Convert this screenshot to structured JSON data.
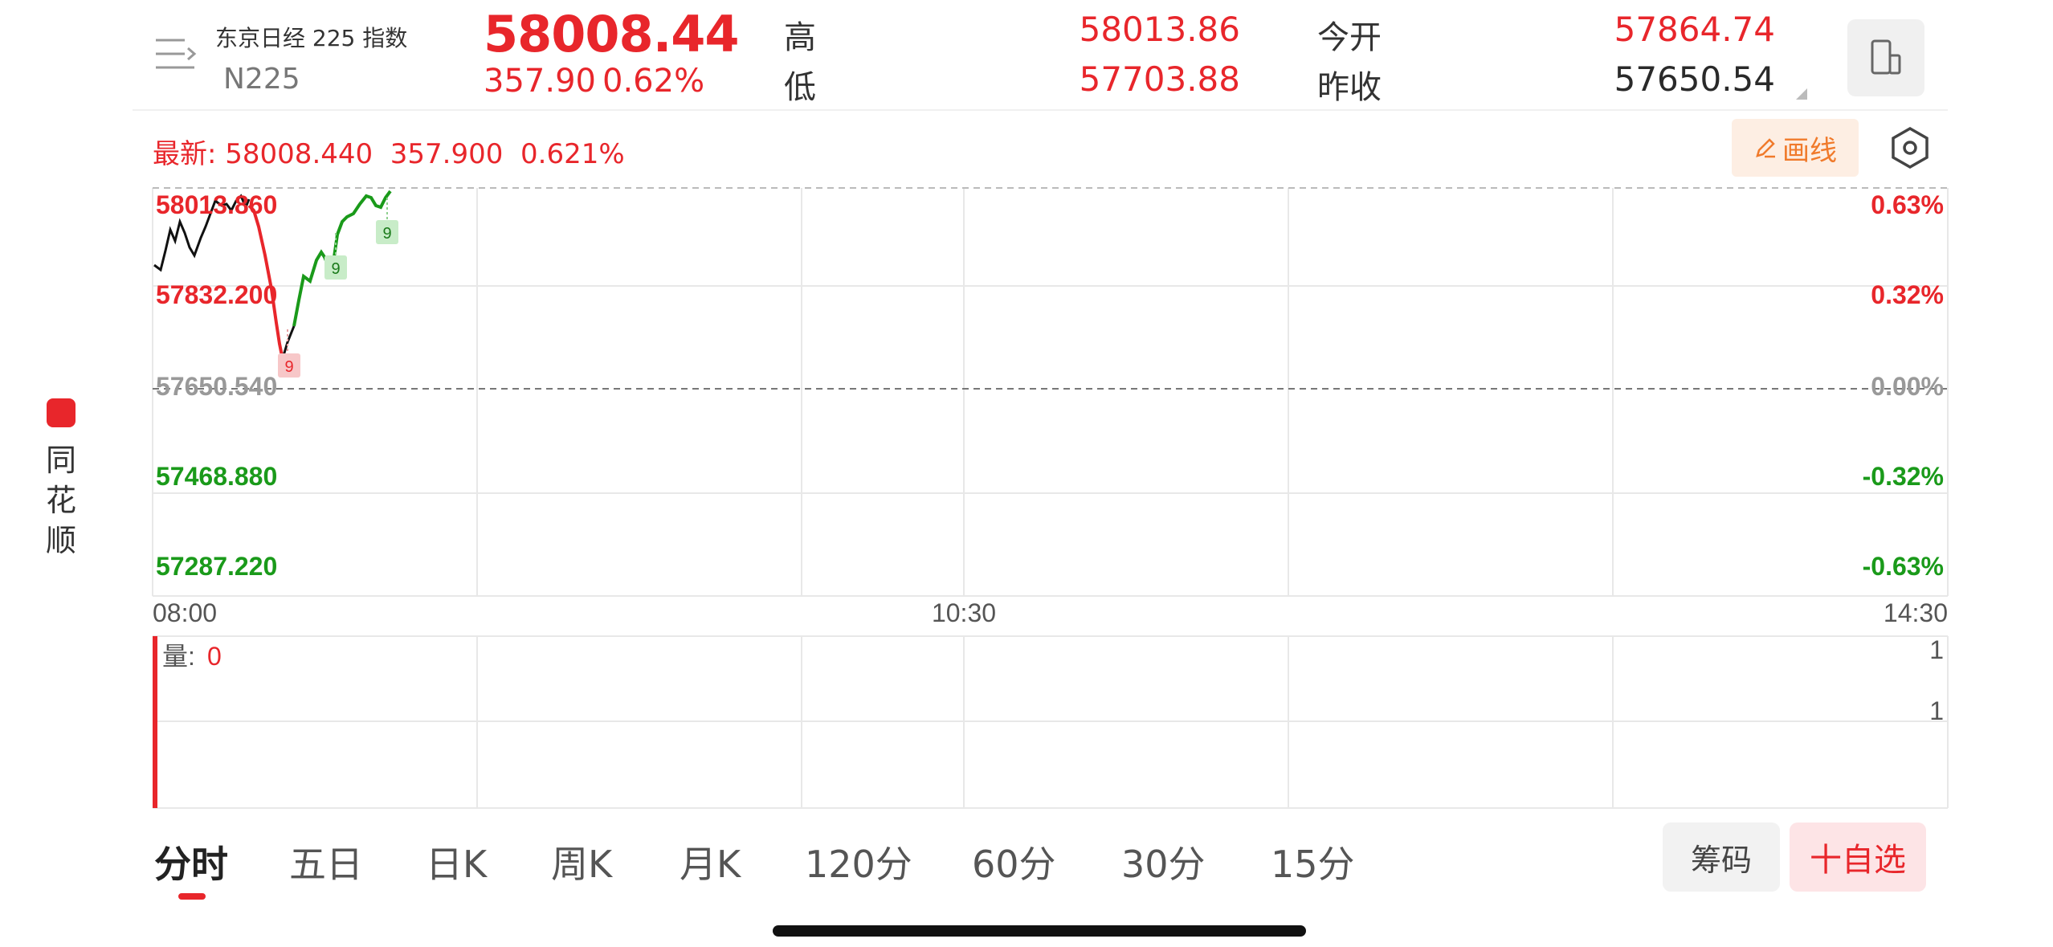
{
  "header": {
    "name": "东京日经 225 指数",
    "code": "N225",
    "price": "58008.44",
    "change": "357.90",
    "change_pct": "0.62%",
    "high_label": "高",
    "high": "58013.86",
    "low_label": "低",
    "low": "57703.88",
    "open_label": "今开",
    "open": "57864.74",
    "prev_close_label": "昨收",
    "prev_close": "57650.54",
    "menu_icon": "list-menu-icon",
    "device_icon": "device-switch-icon"
  },
  "latest": {
    "label": "最新:",
    "price": "58008.440",
    "change": "357.900",
    "change_pct": "0.621%"
  },
  "toolbar": {
    "draw_label": "画线",
    "draw_icon": "pencil-icon",
    "settings_icon": "hexagon-settings-icon"
  },
  "price_axis": {
    "left_labels": [
      "58013.860",
      "57832.200",
      "57650.540",
      "57468.880",
      "57287.220"
    ],
    "right_labels": [
      "0.63%",
      "0.32%",
      "0.00%",
      "-0.32%",
      "-0.63%"
    ]
  },
  "time_axis": {
    "labels": [
      "08:00",
      "10:30",
      "14:30"
    ]
  },
  "volume": {
    "label": "量:",
    "value": "0",
    "right_labels": [
      "1",
      "1"
    ]
  },
  "markers": [
    "9",
    "9",
    "9"
  ],
  "tabs": [
    "分时",
    "五日",
    "日K",
    "周K",
    "月K",
    "120分",
    "60分",
    "30分",
    "15分"
  ],
  "buttons": {
    "chips": "筹码",
    "add_watch": "十自选"
  },
  "brand": {
    "text": "同花顺",
    "icon": "tonghuashun-logo-icon"
  },
  "colors": {
    "up": "#e8262b",
    "down": "#1a9a1a",
    "price_line": "#111111",
    "grid": "#e6e6e6",
    "draw_button_bg": "#fdeee3",
    "watch_button_bg": "#fde4e6"
  }
}
